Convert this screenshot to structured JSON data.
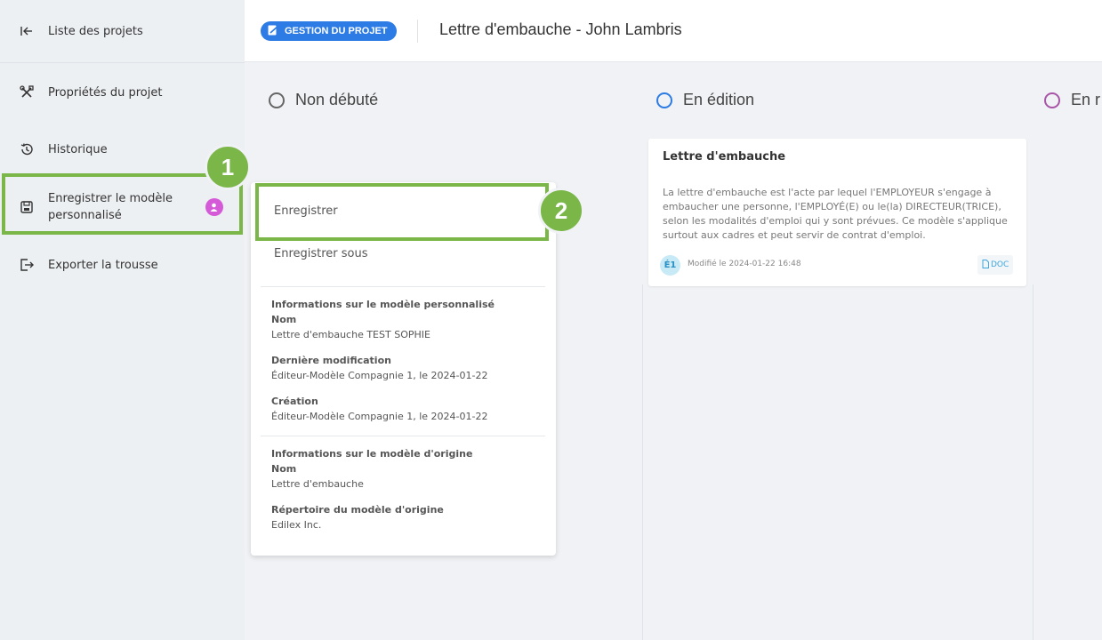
{
  "sidebar": {
    "items": [
      {
        "label": "Liste des projets",
        "icon": "arrow-left-bar-icon"
      },
      {
        "label": "Propriétés du projet",
        "icon": "tools-icon"
      },
      {
        "label": "Historique",
        "icon": "history-icon"
      },
      {
        "label": "Enregistrer le modèle personnalisé",
        "icon": "floppy-disk-icon"
      },
      {
        "label": "Exporter la trousse",
        "icon": "export-icon"
      }
    ]
  },
  "steps": {
    "one": "1",
    "two": "2"
  },
  "header": {
    "badge": "GESTION DU PROJET",
    "title": "Lettre d'embauche - John Lambris"
  },
  "columns": [
    {
      "label": "Non débuté",
      "color": "#666666"
    },
    {
      "label": "En édition",
      "color": "#2d7be5"
    },
    {
      "label": "En r",
      "color": "#a855a8"
    }
  ],
  "card": {
    "title": "Lettre d'embauche",
    "description": "La lettre d'embauche est l'acte par lequel l'EMPLOYEUR s'engage à embaucher une personne, l'EMPLOYÉ(E) ou le(la) DIRECTEUR(TRICE), selon les modalités d'emploi qui y sont prévues. Ce modèle s'applique surtout aux cadres et peut servir de contrat d'emploi.",
    "avatar": "É1",
    "modified": "Modifié le 2024-01-22 16:48",
    "doc": "DOC"
  },
  "menu": {
    "save": "Enregistrer",
    "save_as": "Enregistrer sous",
    "custom_section": "Informations sur le modèle personnalisé",
    "name_label": "Nom",
    "custom_name": "Lettre d'embauche TEST SOPHIE",
    "last_mod_label": "Dernière modification",
    "last_mod_value": "Éditeur-Modèle Compagnie 1, le 2024-01-22",
    "creation_label": "Création",
    "creation_value": "Éditeur-Modèle Compagnie 1, le 2024-01-22",
    "origin_section": "Informations sur le modèle d'origine",
    "origin_name_label": "Nom",
    "origin_name": "Lettre d'embauche",
    "origin_dir_label": "Répertoire du modèle d'origine",
    "origin_dir": "Edilex Inc."
  },
  "colors": {
    "accent": "#7ab648",
    "brand": "#2d7be5",
    "badge": "#d55ad8"
  }
}
